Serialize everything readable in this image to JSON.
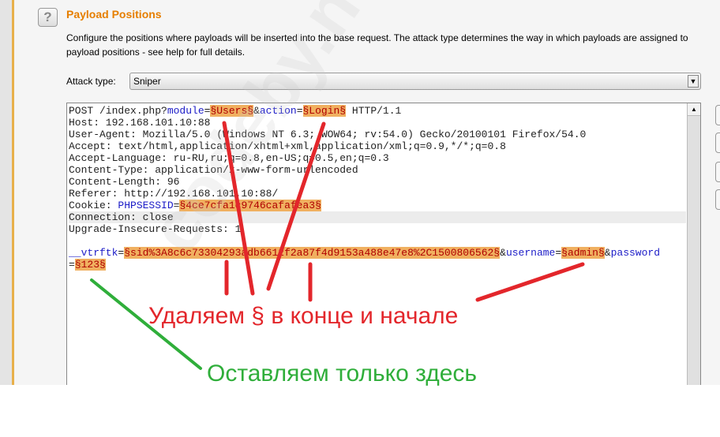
{
  "panel": {
    "title": "Payload Positions",
    "help_icon": "question-icon",
    "description": "Configure the positions where payloads will be inserted into the base request. The attack type determines the way in which payloads are assigned to payload positions - see help for full details.",
    "attack_type_label": "Attack type:",
    "attack_type_value": "Sniper"
  },
  "request_lines": [
    [
      [
        "t",
        "POST /index.php?"
      ],
      [
        "k",
        "module"
      ],
      [
        "t",
        "="
      ],
      [
        "p",
        "§Users§"
      ],
      [
        "t",
        "&"
      ],
      [
        "k",
        "action"
      ],
      [
        "t",
        "="
      ],
      [
        "p",
        "§Login§"
      ],
      [
        "t",
        " HTTP/1.1"
      ]
    ],
    [
      [
        "t",
        "Host: 192.168.101.10:88"
      ]
    ],
    [
      [
        "t",
        "User-Agent: Mozilla/5.0 (Windows NT 6.3; WOW64; rv:54.0) Gecko/20100101 Firefox/54.0"
      ]
    ],
    [
      [
        "t",
        "Accept: text/html,application/xhtml+xml,application/xml;q=0.9,*/*;q=0.8"
      ]
    ],
    [
      [
        "t",
        "Accept-Language: ru-RU,ru;q=0.8,en-US;q=0.5,en;q=0.3"
      ]
    ],
    [
      [
        "t",
        "Content-Type: application/x-www-form-urlencoded"
      ]
    ],
    [
      [
        "t",
        "Content-Length: 96"
      ]
    ],
    [
      [
        "t",
        "Referer: http://192.168.101.10:88/"
      ]
    ],
    [
      [
        "t",
        "Cookie: "
      ],
      [
        "k",
        "PHPSESSID"
      ],
      [
        "t",
        "="
      ],
      [
        "p",
        "§4ce7cfa1c9746cafafea3§"
      ]
    ],
    [
      [
        "t",
        "Connection: close"
      ]
    ],
    [
      [
        "t",
        "Upgrade-Insecure-Requests: 1"
      ]
    ],
    [
      [
        "t",
        ""
      ]
    ],
    [
      [
        "k",
        "__vtrftk"
      ],
      [
        "t",
        "="
      ],
      [
        "p",
        "§sid%3A8c6c73304293adb6612f2a87f4d9153a488e47e8%2C1500806562§"
      ],
      [
        "t",
        "&"
      ],
      [
        "k",
        "username"
      ],
      [
        "t",
        "="
      ],
      [
        "p",
        "§admin§"
      ],
      [
        "t",
        "&"
      ],
      [
        "k",
        "password"
      ]
    ],
    [
      [
        "t",
        "="
      ],
      [
        "p",
        "§123§"
      ]
    ]
  ],
  "watermark": "codeby.net",
  "annotations": {
    "red_text": "Удаляем § в конце и начале",
    "green_text": "Оставляем только здесь",
    "red": "#e3262b",
    "green": "#2fae3a"
  },
  "colors": {
    "title": "#e67e00",
    "payload_bg": "#f0b060",
    "payload_fg": "#b00000",
    "param": "#1b1bc7"
  }
}
